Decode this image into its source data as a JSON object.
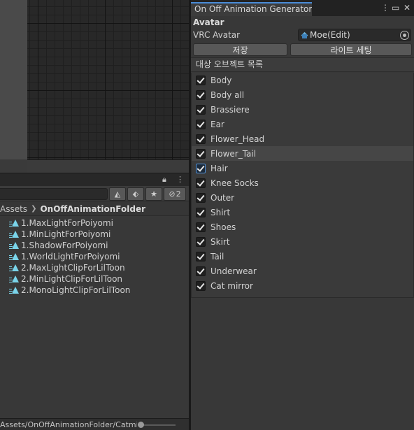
{
  "inspector": {
    "tab_title": "On Off Animation Generator",
    "avatar_section": "Avatar",
    "vrc_avatar_label": "VRC Avatar",
    "vrc_avatar_value": "Moe(Edit)",
    "save_button": "저장",
    "light_settings_button": "라이트 세팅",
    "target_list_header": "대상 오브젝트 목록",
    "objects": [
      {
        "label": "Body",
        "checked": true
      },
      {
        "label": "Body all",
        "checked": true
      },
      {
        "label": "Brassiere",
        "checked": true
      },
      {
        "label": "Ear",
        "checked": true
      },
      {
        "label": "Flower_Head",
        "checked": true
      },
      {
        "label": "Flower_Tail",
        "checked": true
      },
      {
        "label": "Hair",
        "checked": true
      },
      {
        "label": "Knee Socks",
        "checked": true
      },
      {
        "label": "Outer",
        "checked": true
      },
      {
        "label": "Shirt",
        "checked": true
      },
      {
        "label": "Shoes",
        "checked": true
      },
      {
        "label": "Skirt",
        "checked": true
      },
      {
        "label": "Tail",
        "checked": true
      },
      {
        "label": "Underwear",
        "checked": true
      },
      {
        "label": "Cat mirror",
        "checked": true
      }
    ]
  },
  "project": {
    "hidden_count": "2",
    "breadcrumb": {
      "root": "Assets",
      "current": "OnOffAnimationFolder"
    },
    "assets": [
      "1.MaxLightForPoiyomi",
      "1.MinLightForPoiyomi",
      "1.ShadowForPoiyomi",
      "1.WorldLightForPoiyomi",
      "2.MaxLightClipForLilToon",
      "2.MinLightClipForLilToon",
      "2.MonoLightClipForLilToon"
    ],
    "status_path": "Assets/OnOffAnimationFolder/Catmirror.anim"
  },
  "colors": {
    "accent": "#4a8cd8",
    "anim_icon": "#7ad4ea"
  }
}
